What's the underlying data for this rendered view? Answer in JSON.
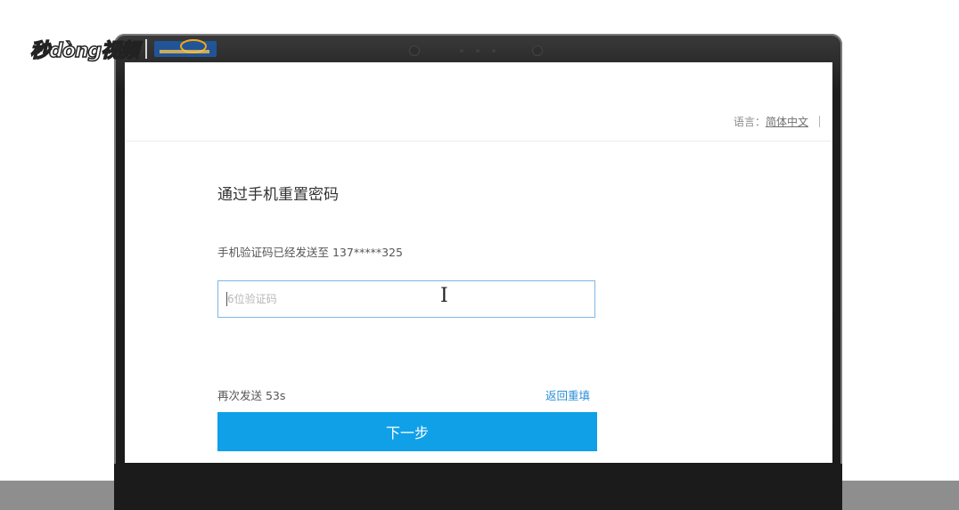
{
  "watermark": {
    "brand": "秒dòng视频",
    "partner_logo": "partner-logo"
  },
  "header": {
    "language_label": "语言：",
    "language_value": "简体中文"
  },
  "form": {
    "title": "通过手机重置密码",
    "sent_info": "手机验证码已经发送至 137*****325",
    "code_input": {
      "placeholder": "6位验证码",
      "value": ""
    },
    "resend_text": "再次发送 53s",
    "back_link": "返回重填",
    "next_button": "下一步"
  },
  "colors": {
    "accent": "#10a0e8",
    "link": "#2b8fd6",
    "input_border": "#7fb6e6"
  }
}
